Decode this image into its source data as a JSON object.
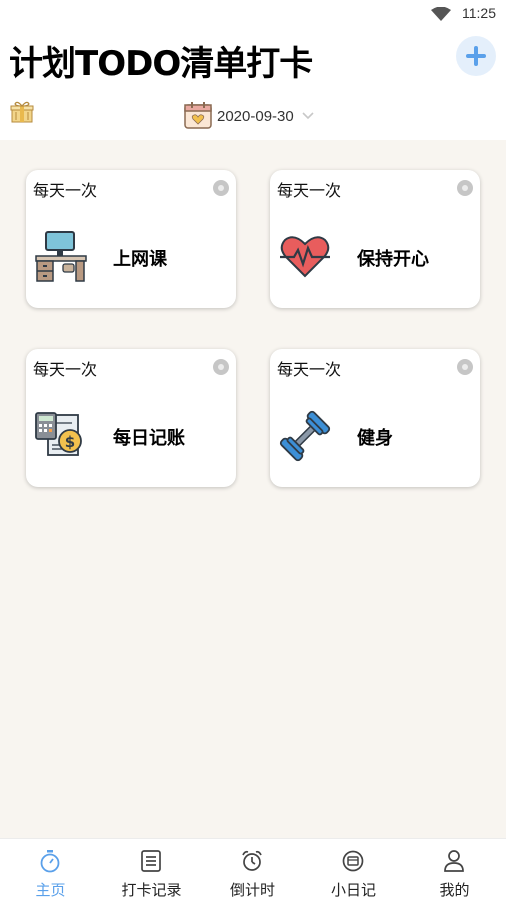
{
  "status_bar": {
    "time": "11:25"
  },
  "header": {
    "title": "计划TODO清单打卡",
    "add_button": "+"
  },
  "date_bar": {
    "date": "2020-09-30"
  },
  "tasks": [
    {
      "frequency": "每天一次",
      "name": "上网课",
      "icon": "computer-desk-icon"
    },
    {
      "frequency": "每天一次",
      "name": "保持开心",
      "icon": "heartbeat-icon"
    },
    {
      "frequency": "每天一次",
      "name": "每日记账",
      "icon": "calculator-money-icon"
    },
    {
      "frequency": "每天一次",
      "name": "健身",
      "icon": "dumbbell-icon"
    }
  ],
  "bottom_nav": [
    {
      "label": "主页",
      "icon": "stopwatch-icon",
      "active": true
    },
    {
      "label": "打卡记录",
      "icon": "list-icon",
      "active": false
    },
    {
      "label": "倒计时",
      "icon": "alarm-clock-icon",
      "active": false
    },
    {
      "label": "小日记",
      "icon": "diary-icon",
      "active": false
    },
    {
      "label": "我的",
      "icon": "user-icon",
      "active": false
    }
  ],
  "colors": {
    "accent": "#5aa0ea",
    "content_bg": "#f8f5f0",
    "add_bg": "#e4effb"
  }
}
